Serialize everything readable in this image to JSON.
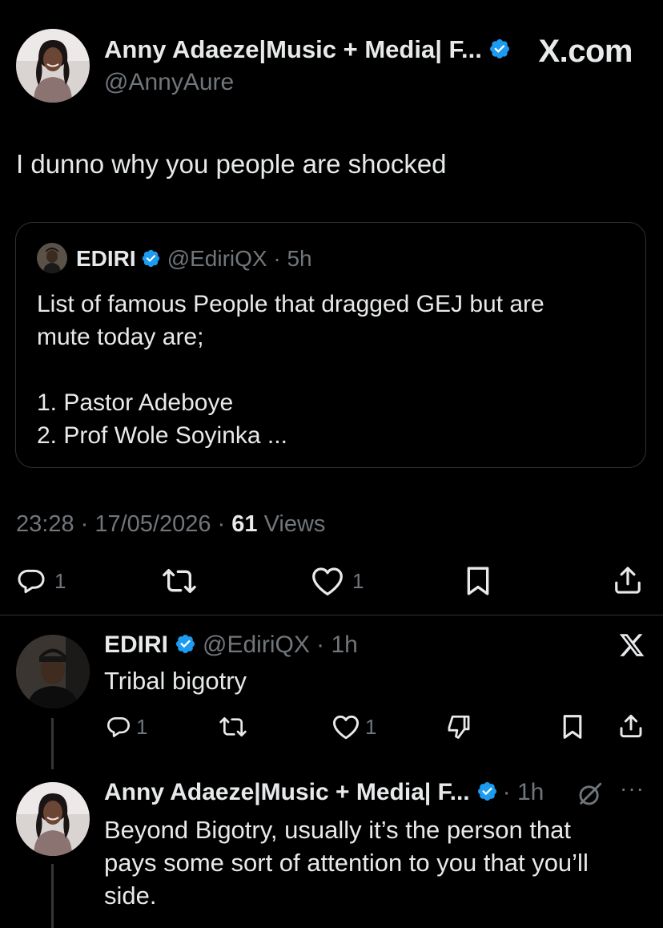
{
  "main_tweet": {
    "author_name": "Anny Adaeze|Music + Media| F...",
    "author_handle": "@AnnyAure",
    "brand": "X.com",
    "text": "I dunno why you people are shocked",
    "timestamp": "23:28 · 17/05/2026 ·",
    "views_count": "61",
    "views_label": "Views",
    "reply_count": "1",
    "like_count": "1"
  },
  "quoted_tweet": {
    "author_name": "EDIRI",
    "author_handle": "@EdiriQX · 5h",
    "lines": [
      "List of famous People that dragged GEJ but are",
      "mute today are;",
      "",
      "1. Pastor Adeboye",
      "2. Prof Wole Soyinka ..."
    ]
  },
  "reply_1": {
    "author_name": "EDIRI",
    "author_handle": "@EdiriQX · 1h",
    "text": "Tribal bigotry",
    "reply_count": "1",
    "like_count": "1"
  },
  "reply_2": {
    "author_name": "Anny Adaeze|Music + Media| F...",
    "time": "· 1h",
    "more_label": "···",
    "lines": [
      "Beyond Bigotry, usually it’s the person that",
      "pays some sort of attention to you that you’ll",
      "side."
    ]
  },
  "colors": {
    "background": "#000000",
    "text_primary": "#e7e9ea",
    "text_secondary": "#71767b",
    "verified_blue": "#1d9bf0",
    "border": "#2f3336"
  },
  "icons": {
    "verified": "verified-badge-icon",
    "reply": "reply-icon",
    "retweet": "retweet-icon",
    "like": "heart-icon",
    "bookmark": "bookmark-icon",
    "share": "share-icon",
    "dislike": "dislike-icon",
    "grok": "grok-icon",
    "x_logo": "x-logo-icon"
  }
}
